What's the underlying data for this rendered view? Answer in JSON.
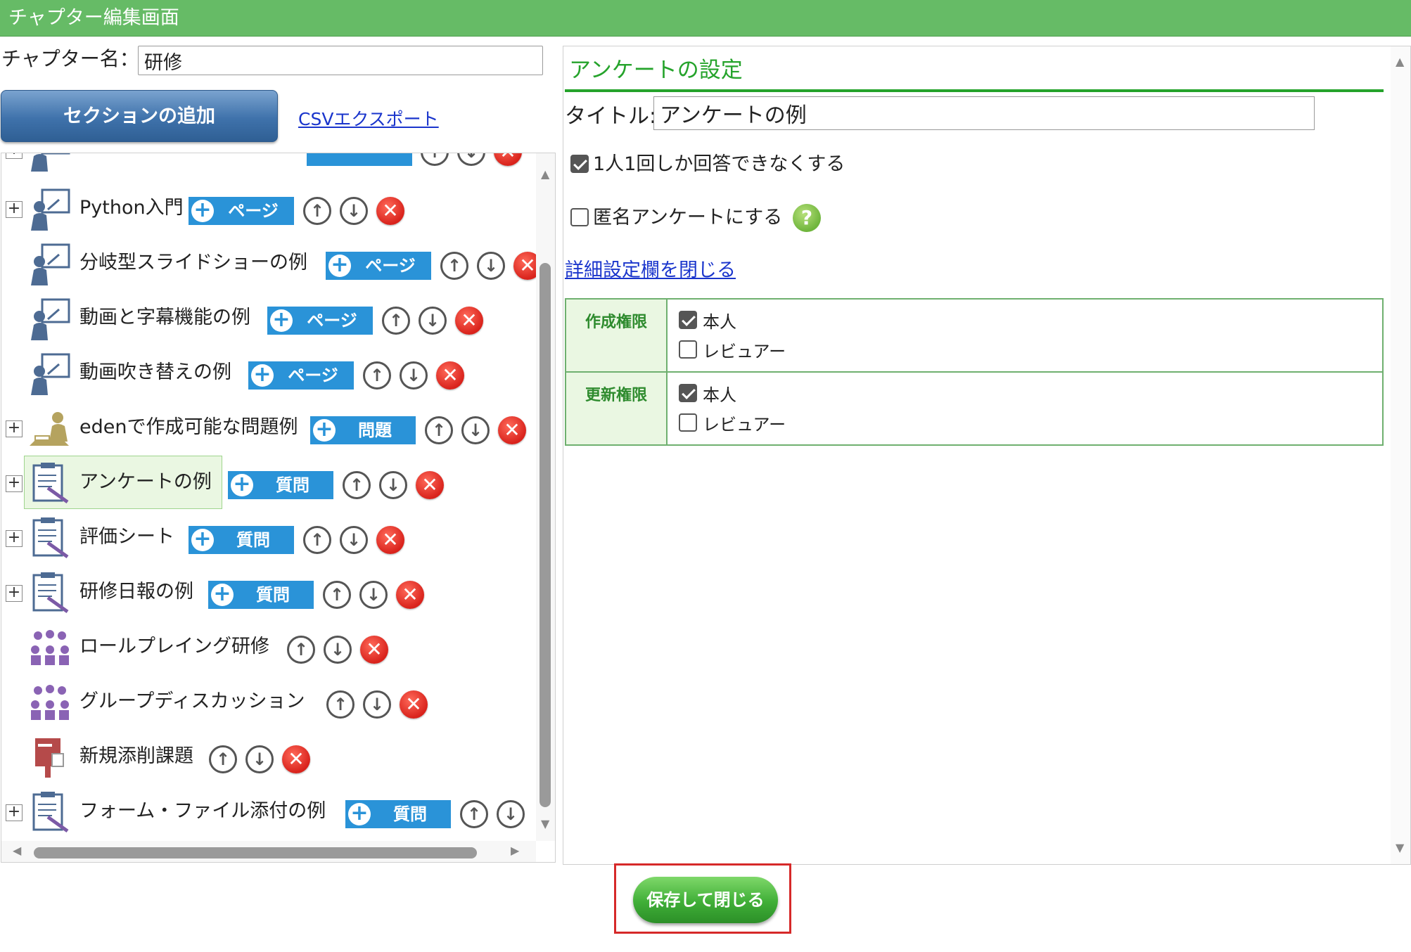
{
  "window": {
    "title": "チャプター編集画面"
  },
  "chapter": {
    "label": "チャプター名：",
    "value": "研修"
  },
  "toolbar": {
    "add_section": "セクションの追加",
    "csv_export": "CSVエクスポート"
  },
  "tree": {
    "items": [
      {
        "label": "Python入門",
        "add": "ページ"
      },
      {
        "label": "分岐型スライドショーの例",
        "add": "ページ"
      },
      {
        "label": "動画と字幕機能の例",
        "add": "ページ"
      },
      {
        "label": "動画吹き替えの例",
        "add": "ページ"
      },
      {
        "label": "edenで作成可能な問題例",
        "add": "問題"
      },
      {
        "label": "アンケートの例",
        "add": "質問"
      },
      {
        "label": "評価シート",
        "add": "質問"
      },
      {
        "label": "研修日報の例",
        "add": "質問"
      },
      {
        "label": "ロールプレイング研修"
      },
      {
        "label": "グループディスカッション"
      },
      {
        "label": "新規添削課題"
      },
      {
        "label": "フォーム・ファイル添付の例",
        "add": "質問"
      }
    ]
  },
  "survey": {
    "heading": "アンケートの設定",
    "title_label": "タイトル:",
    "title_value": "アンケートの例",
    "once_label": "1人1回しか回答できなくする",
    "anon_label": "匿名アンケートにする",
    "help_icon": "?",
    "detail_link": "詳細設定欄を閉じる",
    "permissions": {
      "create": {
        "head": "作成権限",
        "self": "本人",
        "reviewer": "レビュアー"
      },
      "update": {
        "head": "更新権限",
        "self": "本人",
        "reviewer": "レビュアー"
      }
    }
  },
  "footer": {
    "save_close": "保存して閉じる"
  },
  "glyphs": {
    "up": "↑",
    "down": "↓",
    "del": "✕",
    "plus": "+",
    "expand": "+"
  }
}
